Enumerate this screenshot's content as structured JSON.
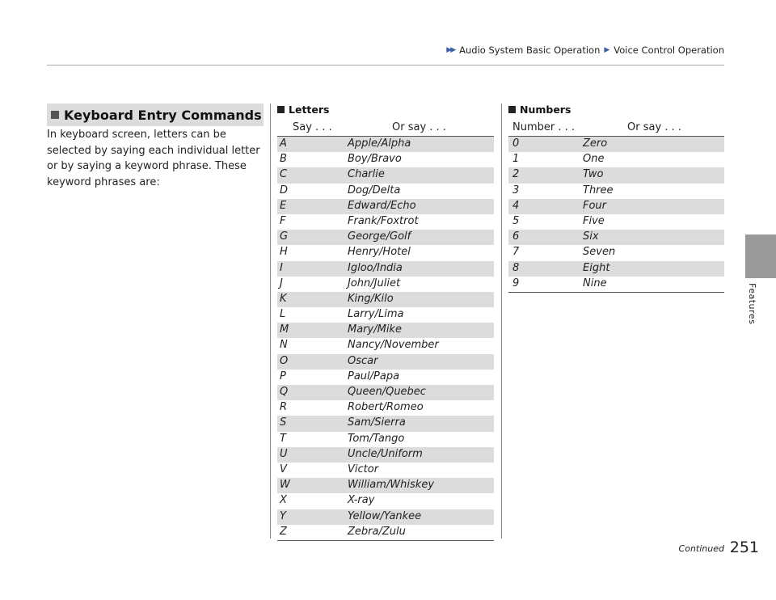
{
  "breadcrumb": {
    "section": "Audio System Basic Operation",
    "subsection": "Voice Control Operation"
  },
  "side_tab": {
    "label": "Features"
  },
  "section": {
    "title": "Keyboard Entry Commands",
    "intro": "In keyboard screen, letters can be selected by saying each individual letter or by saying a keyword phrase. These keyword phrases are:"
  },
  "letters": {
    "title": "Letters",
    "col1": "Say . . .",
    "col2": "Or say . . .",
    "rows": [
      {
        "key": "A",
        "phrase": "Apple/Alpha"
      },
      {
        "key": "B",
        "phrase": "Boy/Bravo"
      },
      {
        "key": "C",
        "phrase": "Charlie"
      },
      {
        "key": "D",
        "phrase": "Dog/Delta"
      },
      {
        "key": "E",
        "phrase": "Edward/Echo"
      },
      {
        "key": "F",
        "phrase": "Frank/Foxtrot"
      },
      {
        "key": "G",
        "phrase": "George/Golf"
      },
      {
        "key": "H",
        "phrase": "Henry/Hotel"
      },
      {
        "key": "I",
        "phrase": "Igloo/India"
      },
      {
        "key": "J",
        "phrase": "John/Juliet"
      },
      {
        "key": "K",
        "phrase": "King/Kilo"
      },
      {
        "key": "L",
        "phrase": "Larry/Lima"
      },
      {
        "key": "M",
        "phrase": "Mary/Mike"
      },
      {
        "key": "N",
        "phrase": "Nancy/November"
      },
      {
        "key": "O",
        "phrase": "Oscar"
      },
      {
        "key": "P",
        "phrase": "Paul/Papa"
      },
      {
        "key": "Q",
        "phrase": "Queen/Quebec"
      },
      {
        "key": "R",
        "phrase": "Robert/Romeo"
      },
      {
        "key": "S",
        "phrase": "Sam/Sierra"
      },
      {
        "key": "T",
        "phrase": "Tom/Tango"
      },
      {
        "key": "U",
        "phrase": "Uncle/Uniform"
      },
      {
        "key": "V",
        "phrase": "Victor"
      },
      {
        "key": "W",
        "phrase": "William/Whiskey"
      },
      {
        "key": "X",
        "phrase": "X-ray"
      },
      {
        "key": "Y",
        "phrase": "Yellow/Yankee"
      },
      {
        "key": "Z",
        "phrase": "Zebra/Zulu"
      }
    ]
  },
  "numbers": {
    "title": "Numbers",
    "col1": "Number . . .",
    "col2": "Or say . . .",
    "rows": [
      {
        "key": "0",
        "phrase": "Zero"
      },
      {
        "key": "1",
        "phrase": "One"
      },
      {
        "key": "2",
        "phrase": "Two"
      },
      {
        "key": "3",
        "phrase": "Three"
      },
      {
        "key": "4",
        "phrase": "Four"
      },
      {
        "key": "5",
        "phrase": "Five"
      },
      {
        "key": "6",
        "phrase": "Six"
      },
      {
        "key": "7",
        "phrase": "Seven"
      },
      {
        "key": "8",
        "phrase": "Eight"
      },
      {
        "key": "9",
        "phrase": "Nine"
      }
    ]
  },
  "footer": {
    "continued": "Continued",
    "page_number": "251"
  }
}
